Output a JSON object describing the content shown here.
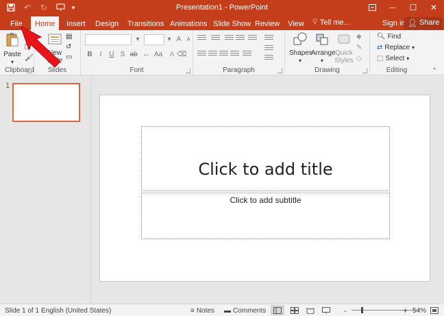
{
  "window": {
    "title": "Presentation1 - PowerPoint",
    "minimize_icon": "minimize-icon",
    "restore_icon": "restore-icon",
    "close_icon": "close-icon"
  },
  "quick_access": [
    "save-icon",
    "undo-icon",
    "redo-icon",
    "start-from-beginning-icon",
    "customize-dropdown-icon"
  ],
  "tabs": [
    {
      "label": "File"
    },
    {
      "label": "Home"
    },
    {
      "label": "Insert"
    },
    {
      "label": "Design"
    },
    {
      "label": "Transitions"
    },
    {
      "label": "Animations"
    },
    {
      "label": "Slide Show"
    },
    {
      "label": "Review"
    },
    {
      "label": "View"
    }
  ],
  "tell_me": "Tell me...",
  "sign_in": "Sign in",
  "share": "Share",
  "ribbon": {
    "clipboard": {
      "label": "Clipboard",
      "paste": "Paste"
    },
    "slides": {
      "label": "Slides",
      "new_slide_1": "New",
      "new_slide_2": "Slide"
    },
    "font": {
      "label": "Font"
    },
    "paragraph": {
      "label": "Paragraph"
    },
    "drawing": {
      "label": "Drawing",
      "shapes": "Shapes",
      "arrange": "Arrange",
      "quick_styles_1": "Quick",
      "quick_styles_2": "Styles"
    },
    "editing": {
      "label": "Editing",
      "find": "Find",
      "replace": "Replace",
      "select": "Select"
    }
  },
  "thumbnail": {
    "number": "1"
  },
  "slide": {
    "title_placeholder": "Click to add title",
    "subtitle_placeholder": "Click to add subtitle"
  },
  "status": {
    "slide_info": "Slide 1 of 1",
    "language": "English (United States)",
    "notes": "Notes",
    "comments": "Comments",
    "zoom_minus": "-",
    "zoom_plus": "+",
    "zoom": "54%"
  },
  "colors": {
    "accent": "#c43e1c",
    "annotation_arrow": "#e8141c"
  }
}
